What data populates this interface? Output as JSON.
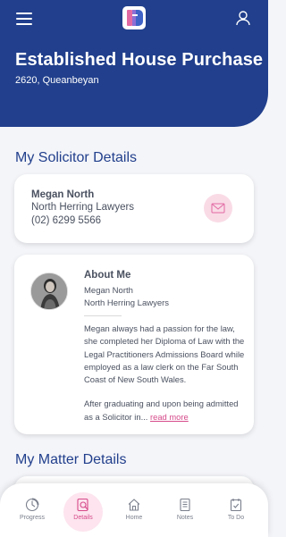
{
  "header": {
    "property_title": "Established House Purchase",
    "property_subtitle": "2620, Queanbeyan"
  },
  "solicitor_section": {
    "title": "My Solicitor Details",
    "name": "Megan North",
    "firm": "North Herring Lawyers",
    "phone": "(02) 6299 5566"
  },
  "about": {
    "heading": "About Me",
    "name": "Megan North",
    "firm": "North Herring Lawyers",
    "bio_para1": "Megan always had a passion for the law, she completed her Diploma of Law with the Legal Practitioners Admissions Board while employed as a law clerk on the Far South Coast of New South Wales.",
    "bio_para2": "After graduating and upon being admitted as a Solicitor in...",
    "read_more": "read more"
  },
  "matter_section": {
    "title": "My Matter Details"
  },
  "nav": [
    {
      "label": "Progress",
      "icon": "progress-icon",
      "active": false
    },
    {
      "label": "Details",
      "icon": "details-icon",
      "active": true
    },
    {
      "label": "Home",
      "icon": "home-icon",
      "active": false
    },
    {
      "label": "Notes",
      "icon": "notes-icon",
      "active": false
    },
    {
      "label": "To Do",
      "icon": "todo-icon",
      "active": false
    }
  ],
  "colors": {
    "header_bg": "#213f8c",
    "accent_pink": "#d64a8a",
    "text": "#4a5160"
  }
}
